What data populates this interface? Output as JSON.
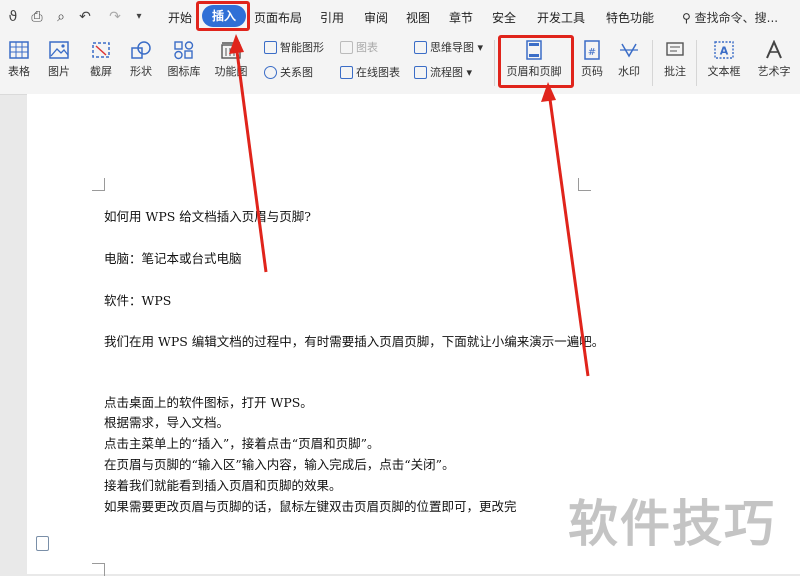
{
  "menubar": {
    "tabs": [
      "开始",
      "插入",
      "页面布局",
      "引用",
      "审阅",
      "视图",
      "章节",
      "安全",
      "开发工具",
      "特色功能"
    ],
    "active_tab": "插入",
    "search_text": "查找命令、搜..."
  },
  "ribbon": {
    "large_buttons": [
      "表格",
      "图片",
      "截屏",
      "形状",
      "图标库",
      "功能图",
      "页眉和页脚",
      "页码",
      "水印",
      "批注",
      "文本框",
      "艺术字"
    ],
    "small_buttons": [
      "智能图形",
      "图表",
      "思维导图",
      "关系图",
      "在线图表",
      "流程图"
    ],
    "highlighted_button": "页眉和页脚"
  },
  "document": {
    "lines": [
      "如何用 WPS 给文档插入页眉与页脚?",
      "电脑：笔记本或台式电脑",
      "软件：WPS",
      "我们在用 WPS 编辑文档的过程中，有时需要插入页眉页脚，下面就让小编来演示一遍吧。",
      "点击桌面上的软件图标，打开 WPS。",
      "根据需求，导入文档。",
      "点击主菜单上的“插入”，接着点击“页眉和页脚”。",
      "在页眉与页脚的“输入区”输入内容，输入完成后，点击“关闭”。",
      "接着我们就能看到插入页眉和页脚的效果。",
      "如果需要更改页眉与页脚的话，鼠标左键双击页眉页脚的位置即可，更改完"
    ]
  },
  "watermark": "软件技巧",
  "colors": {
    "accent": "#2f6fd6",
    "highlight": "#e0241b",
    "icon": "#3b6dc7"
  }
}
